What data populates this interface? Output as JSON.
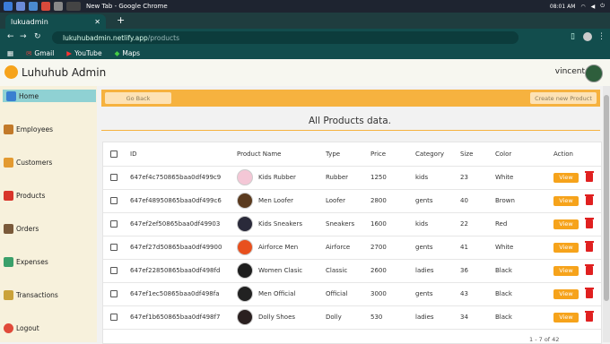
{
  "taskbar": {
    "window_title": "New Tab - Google Chrome",
    "time": "08:01 AM"
  },
  "browser": {
    "tab_title": "lukuadmin",
    "url_host": "lukuhubadmin.netlify.app",
    "url_path": "/products",
    "bookmarks": [
      "Gmail",
      "YouTube",
      "Maps"
    ]
  },
  "app": {
    "brand": "Luhuhub Admin",
    "user_name": "vincent"
  },
  "sidebar": {
    "items": [
      {
        "label": "Home",
        "icon": "home-icon",
        "active": true
      },
      {
        "label": "Employees",
        "icon": "employees-icon"
      },
      {
        "label": "Customers",
        "icon": "customers-icon"
      },
      {
        "label": "Products",
        "icon": "products-icon"
      },
      {
        "label": "Orders",
        "icon": "orders-icon"
      },
      {
        "label": "Expenses",
        "icon": "expenses-icon"
      },
      {
        "label": "Transactions",
        "icon": "transactions-icon"
      },
      {
        "label": "Logout",
        "icon": "logout-icon"
      }
    ]
  },
  "main": {
    "go_back": "Go Back",
    "create_button": "Create new Product",
    "title": "All Products data.",
    "pager": "1 - 7 of 42"
  },
  "table": {
    "columns": [
      "ID",
      "Product Name",
      "Type",
      "Price",
      "Category",
      "Size",
      "Color",
      "Action"
    ],
    "view_label": "View",
    "rows": [
      {
        "id": "647ef4c750865baa0df499c9",
        "name": "Kids Rubber",
        "type": "Rubber",
        "price": "1250",
        "category": "kids",
        "size": "23",
        "color": "White"
      },
      {
        "id": "647ef48950865baa0df499c6",
        "name": "Men Loofer",
        "type": "Loofer",
        "price": "2800",
        "category": "gents",
        "size": "40",
        "color": "Brown"
      },
      {
        "id": "647ef2ef50865baa0df49903",
        "name": "Kids Sneakers",
        "type": "Sneakers",
        "price": "1600",
        "category": "kids",
        "size": "22",
        "color": "Red"
      },
      {
        "id": "647ef27d50865baa0df49900",
        "name": "Airforce Men",
        "type": "Airforce",
        "price": "2700",
        "category": "gents",
        "size": "41",
        "color": "White"
      },
      {
        "id": "647ef22850865baa0df498fd",
        "name": "Women Clasic",
        "type": "Classic",
        "price": "2600",
        "category": "ladies",
        "size": "36",
        "color": "Black"
      },
      {
        "id": "647ef1ec50865baa0df498fa",
        "name": "Men Official",
        "type": "Official",
        "price": "3000",
        "category": "gents",
        "size": "43",
        "color": "Black"
      },
      {
        "id": "647ef1b650865baa0df498f7",
        "name": "Dolly Shoes",
        "type": "Dolly",
        "price": "530",
        "category": "ladies",
        "size": "34",
        "color": "Black"
      }
    ]
  },
  "colors": {
    "accent": "#f6b23f",
    "view_button": "#f6a31b",
    "delete": "#e02020",
    "sidebar_bg": "#f7f1dc",
    "active_item": "#8fd1d3"
  }
}
